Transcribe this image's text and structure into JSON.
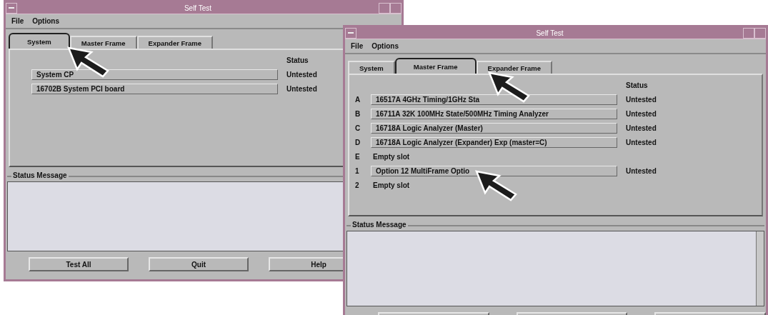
{
  "windows": [
    {
      "title": "Self Test",
      "menus": [
        "File",
        "Options"
      ],
      "tabs": [
        {
          "label": "System",
          "selected": true
        },
        {
          "label": "Master Frame",
          "selected": false
        },
        {
          "label": "Expander Frame",
          "selected": false
        }
      ],
      "status_header": "Status",
      "rows": [
        {
          "kind": "module",
          "name": "System CP",
          "status": "Untested"
        },
        {
          "kind": "module",
          "name": "16702B System PCI board",
          "status": "Untested"
        }
      ],
      "status_message_label": "Status Message",
      "scrollbar": false,
      "buttons": [
        "Test All",
        "Quit",
        "Help"
      ],
      "cut_off_buttons": false
    },
    {
      "title": "Self Test",
      "menus": [
        "File",
        "Options"
      ],
      "tabs": [
        {
          "label": "System",
          "selected": false
        },
        {
          "label": "Master Frame",
          "selected": true
        },
        {
          "label": "Expander Frame",
          "selected": false
        }
      ],
      "status_header": "Status",
      "rows": [
        {
          "kind": "module",
          "slot": "A",
          "name": "16517A 4GHz Timing/1GHz Sta",
          "status": "Untested"
        },
        {
          "kind": "module",
          "slot": "B",
          "name": "16711A 32K 100MHz State/500MHz Timing Analyzer",
          "status": "Untested"
        },
        {
          "kind": "module",
          "slot": "C",
          "name": "16718A Logic Analyzer (Master)",
          "status": "Untested"
        },
        {
          "kind": "module",
          "slot": "D",
          "name": "16718A Logic Analyzer (Expander) Exp (master=C)",
          "status": "Untested"
        },
        {
          "kind": "empty",
          "slot": "E",
          "name": "Empty slot"
        },
        {
          "kind": "module",
          "slot": "1",
          "name": "Option 12 MultiFrame Optio",
          "status": "Untested"
        },
        {
          "kind": "empty",
          "slot": "2",
          "name": "Empty slot"
        }
      ],
      "status_message_label": "Status Message",
      "scrollbar": true,
      "cut_off_buttons": true
    }
  ]
}
